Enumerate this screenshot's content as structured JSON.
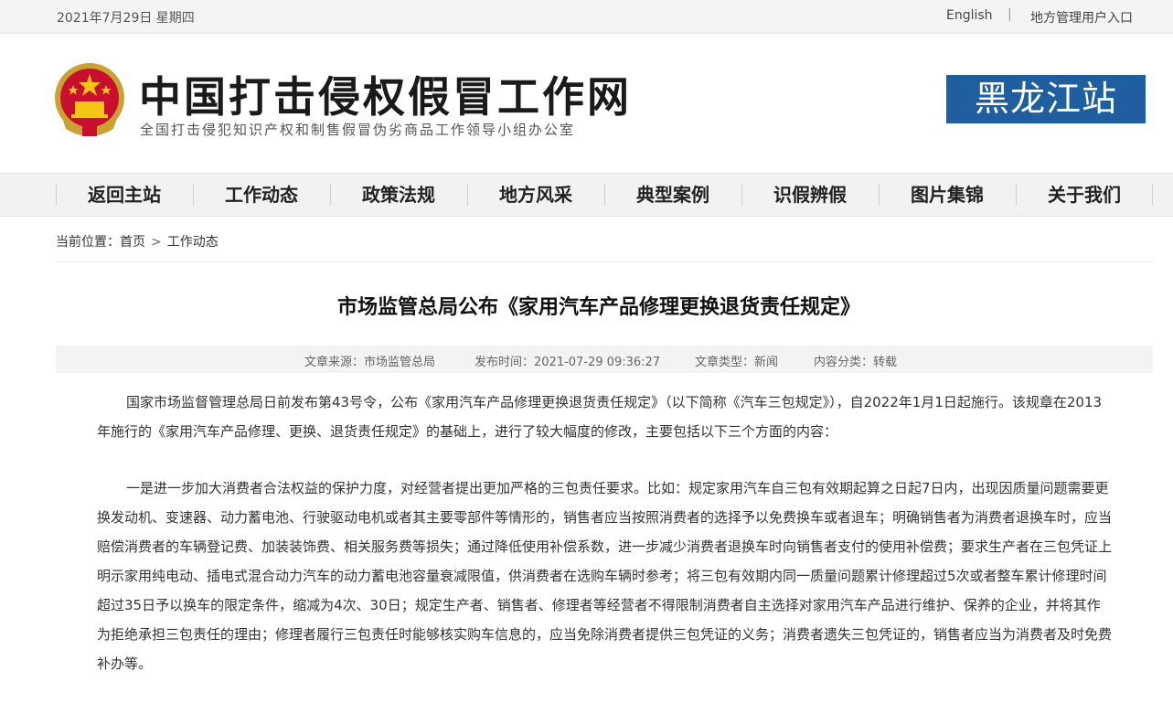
{
  "topbar": {
    "date": "2021年7月29日 星期四",
    "english": "English",
    "separator": "|",
    "local_entry": "地方管理用户入口"
  },
  "header": {
    "title": "中国打击侵权假冒工作网",
    "subtitle": "全国打击侵犯知识产权和制售假冒伪劣商品工作领导小组办公室",
    "station": "黑龙江站"
  },
  "nav": {
    "items": [
      "返回主站",
      "工作动态",
      "政策法规",
      "地方风采",
      "典型案例",
      "识假辨假",
      "图片集锦",
      "关于我们"
    ]
  },
  "breadcrumb": {
    "prefix": "当前位置：",
    "home": "首页",
    "arrow": ">",
    "current": "工作动态"
  },
  "article": {
    "title": "市场监管总局公布《家用汽车产品修理更换退货责任规定》",
    "meta": {
      "source": "文章来源：市场监管总局",
      "time": "发布时间：2021-07-29 09:36:27",
      "type": "文章类型：新闻",
      "category": "内容分类：转载"
    },
    "paragraphs": [
      "国家市场监督管理总局日前发布第43号令，公布《家用汽车产品修理更换退货责任规定》（以下简称《汽车三包规定》），自2022年1月1日起施行。该规章在2013年施行的《家用汽车产品修理、更换、退货责任规定》的基础上，进行了较大幅度的修改，主要包括以下三个方面的内容：",
      "一是进一步加大消费者合法权益的保护力度，对经营者提出更加严格的三包责任要求。比如：规定家用汽车自三包有效期起算之日起7日内，出现因质量问题需要更换发动机、变速器、动力蓄电池、行驶驱动电机或者其主要零部件等情形的，销售者应当按照消费者的选择予以免费换车或者退车；明确销售者为消费者退换车时，应当赔偿消费者的车辆登记费、加装装饰费、相关服务费等损失；通过降低使用补偿系数，进一步减少消费者退换车时向销售者支付的使用补偿费；要求生产者在三包凭证上明示家用纯电动、插电式混合动力汽车的动力蓄电池容量衰减限值，供消费者在选购车辆时参考；将三包有效期内同一质量问题累计修理超过5次或者整车累计修理时间超过35日予以换车的限定条件，缩减为4次、30日；规定生产者、销售者、修理者等经营者不得限制消费者自主选择对家用汽车产品进行维护、保养的企业，并将其作为拒绝承担三包责任的理由；修理者履行三包责任时能够核实购车信息的，应当免除消费者提供三包凭证的义务；消费者遗失三包凭证的，销售者应当为消费者及时免费补办等。"
    ]
  }
}
